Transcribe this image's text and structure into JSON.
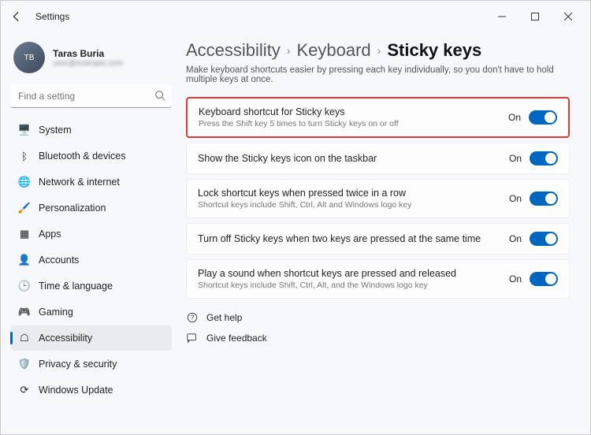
{
  "window": {
    "title": "Settings"
  },
  "profile": {
    "name": "Taras Buria",
    "sub": "user@example.com"
  },
  "search": {
    "placeholder": "Find a setting"
  },
  "sidebar": {
    "items": [
      {
        "label": "System",
        "icon": "🖥️"
      },
      {
        "label": "Bluetooth & devices",
        "icon": "ᛒ"
      },
      {
        "label": "Network & internet",
        "icon": "🌐"
      },
      {
        "label": "Personalization",
        "icon": "🖌️"
      },
      {
        "label": "Apps",
        "icon": "▦"
      },
      {
        "label": "Accounts",
        "icon": "👤"
      },
      {
        "label": "Time & language",
        "icon": "🕒"
      },
      {
        "label": "Gaming",
        "icon": "🎮"
      },
      {
        "label": "Accessibility",
        "icon": "☖"
      },
      {
        "label": "Privacy & security",
        "icon": "🛡️"
      },
      {
        "label": "Windows Update",
        "icon": "⟳"
      }
    ],
    "active_index": 8
  },
  "breadcrumb": {
    "items": [
      "Accessibility",
      "Keyboard",
      "Sticky keys"
    ]
  },
  "description": "Make keyboard shortcuts easier by pressing each key individually, so you don't have to hold multiple keys at once.",
  "settings": [
    {
      "title": "Keyboard shortcut for Sticky keys",
      "sub": "Press the Shift key 5 times to turn Sticky keys on or off",
      "state": "On",
      "highlight": true
    },
    {
      "title": "Show the Sticky keys icon on the taskbar",
      "sub": "",
      "state": "On",
      "highlight": false
    },
    {
      "title": "Lock shortcut keys when pressed twice in a row",
      "sub": "Shortcut keys include Shift, Ctrl, Alt and Windows logo key",
      "state": "On",
      "highlight": false
    },
    {
      "title": "Turn off Sticky keys when two keys are pressed at the same time",
      "sub": "",
      "state": "On",
      "highlight": false
    },
    {
      "title": "Play a sound when shortcut keys are pressed and released",
      "sub": "Shortcut keys include Shift, Ctrl, Alt, and the Windows logo key",
      "state": "On",
      "highlight": false
    }
  ],
  "help": {
    "get_help": "Get help",
    "feedback": "Give feedback"
  },
  "colors": {
    "accent": "#0067c0",
    "highlight_border": "#e23b2e"
  }
}
